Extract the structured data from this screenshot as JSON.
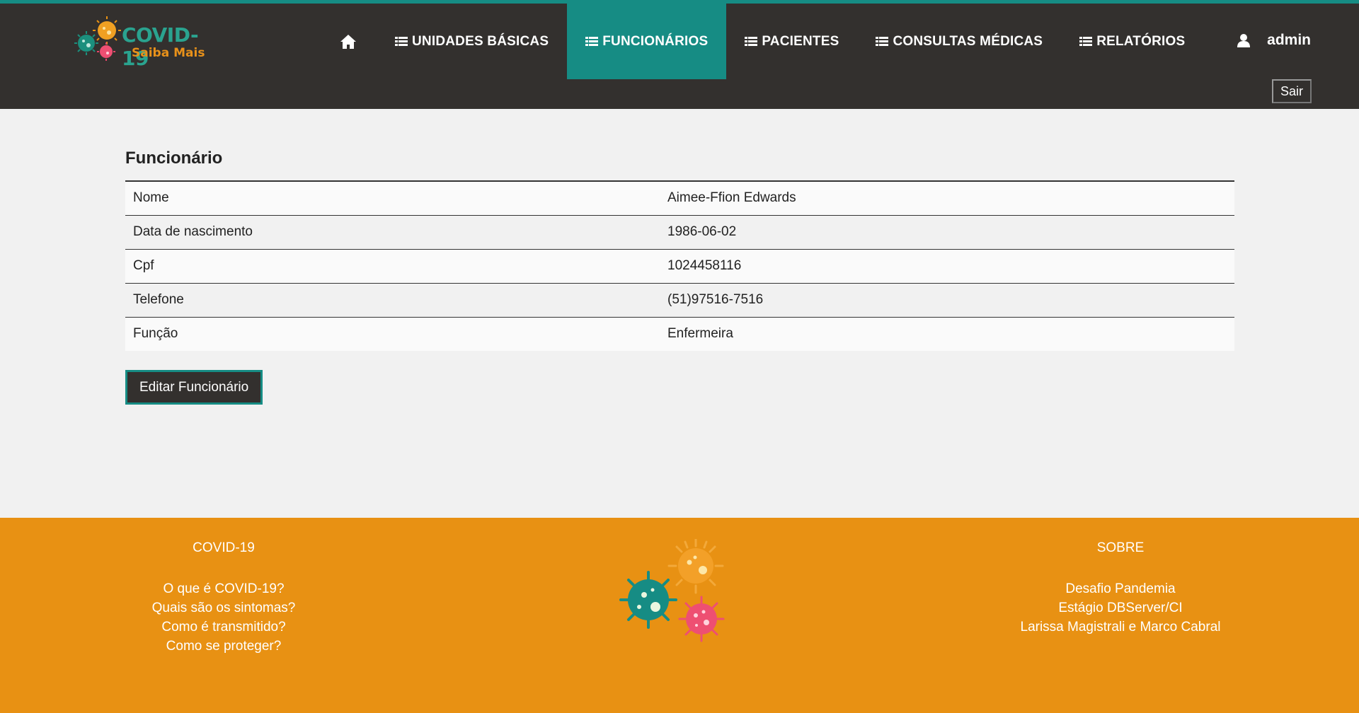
{
  "app": {
    "logo_title": "COVID-19",
    "logo_subtitle": "Saiba Mais"
  },
  "nav": {
    "home_icon": "home-icon",
    "items": [
      {
        "label": "UNIDADES BÁSICAS",
        "icon": "list-icon",
        "active": false
      },
      {
        "label": "FUNCIONÁRIOS",
        "icon": "list-icon",
        "active": true
      },
      {
        "label": "PACIENTES",
        "icon": "list-icon",
        "active": false
      },
      {
        "label": "CONSULTAS MÉDICAS",
        "icon": "list-icon",
        "active": false
      },
      {
        "label": "RELATÓRIOS",
        "icon": "list-icon",
        "active": false
      }
    ],
    "user_icon": "user-icon",
    "user_name": "admin",
    "logout_label": "Sair"
  },
  "main": {
    "title": "Funcionário",
    "rows": [
      {
        "label": "Nome",
        "value": "Aimee-Ffion Edwards"
      },
      {
        "label": "Data de nascimento",
        "value": "1986-06-02"
      },
      {
        "label": "Cpf",
        "value": "1024458116"
      },
      {
        "label": "Telefone",
        "value": "(51)97516-7516"
      },
      {
        "label": "Função",
        "value": "Enfermeira"
      }
    ],
    "edit_label": "Editar Funcionário"
  },
  "footer": {
    "left": {
      "title": "COVID-19",
      "links": [
        "O que é COVID-19?",
        "Quais são os sintomas?",
        "Como é transmitido?",
        "Como se proteger?"
      ]
    },
    "right": {
      "title": "SOBRE",
      "links": [
        "Desafio Pandemia",
        "Estágio DBServer/CI",
        "Larissa Magistrali e Marco Cabral"
      ]
    }
  },
  "colors": {
    "header_bg": "#33302e",
    "accent_teal": "#168c84",
    "footer_orange": "#e89113",
    "page_bg": "#f1f1f1"
  }
}
